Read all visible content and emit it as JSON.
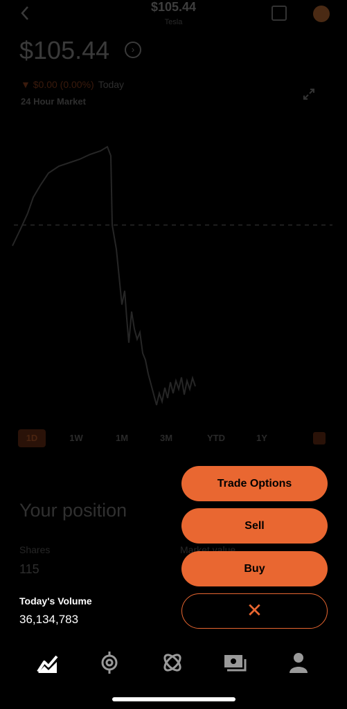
{
  "header": {
    "price": "$105.44",
    "subtitle": "Tesla"
  },
  "quote": {
    "price": "$105.44",
    "change": "▼ $0.00 (0.00%)",
    "change_period": "Today",
    "market_label": "24 Hour Market"
  },
  "chart_ranges": [
    "1D",
    "1W",
    "1M",
    "3M",
    "YTD",
    "1Y"
  ],
  "position": {
    "title": "Your position",
    "shares_label": "Shares",
    "shares_value": "115",
    "market_value_label": "Market value"
  },
  "volume": {
    "label": "Today's Volume",
    "value": "36,134,783"
  },
  "actions": {
    "trade_options": "Trade Options",
    "sell": "Sell",
    "buy": "Buy",
    "close": "✕"
  },
  "tabs": [
    "investing-tab",
    "crypto-tab",
    "explore-tab",
    "cash-tab",
    "account-tab"
  ],
  "colors": {
    "accent": "#e96731",
    "background": "#000000"
  }
}
